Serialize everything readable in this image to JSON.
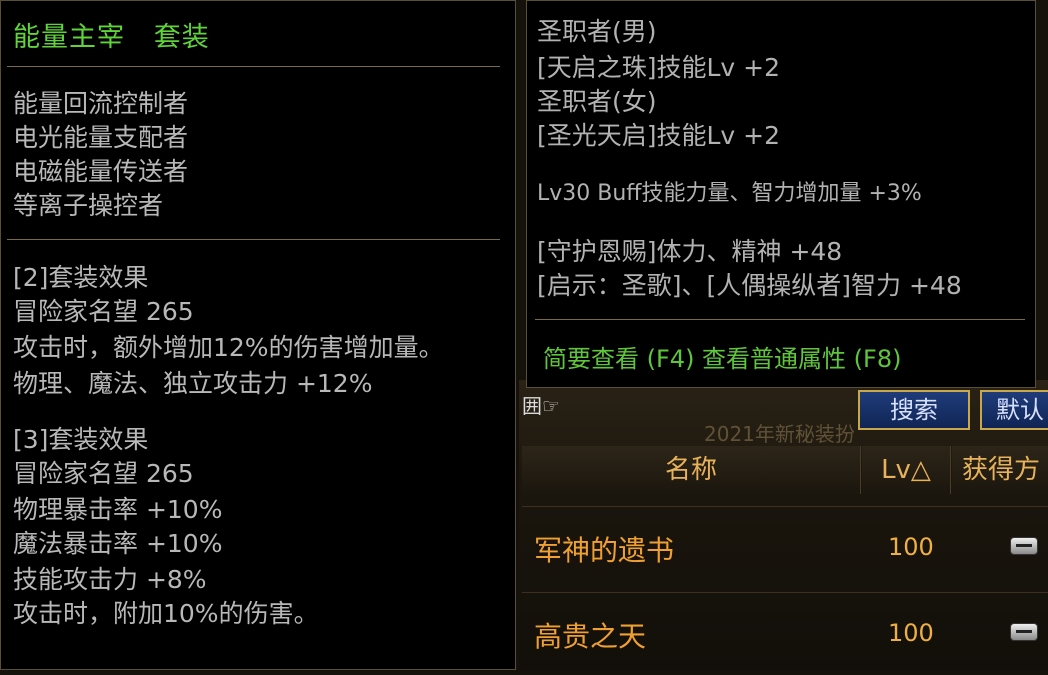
{
  "left_tooltip": {
    "title": "能量主宰   套装",
    "roles": [
      "能量回流控制者",
      "电光能量支配者",
      "电磁能量传送者",
      "等离子操控者"
    ],
    "set2": {
      "header": "[2]套装效果",
      "lines": [
        "冒险家名望 265",
        "攻击时，额外增加12%的伤害增加量。",
        "物理、魔法、独立攻击力 +12%"
      ]
    },
    "set3": {
      "header": "[3]套装效果",
      "lines": [
        "冒险家名望 265",
        "物理暴击率 +10%",
        "魔法暴击率 +10%",
        "技能攻击力 +8%",
        "攻击时，附加10%的伤害。"
      ]
    }
  },
  "right_tooltip": {
    "lines": [
      "圣职者(男)",
      "[天启之珠]技能Lv +2",
      "圣职者(女)",
      "[圣光天启]技能Lv +2"
    ],
    "buff_line": "Lv30 Buff技能力量、智力增加量 +3%",
    "lines2": [
      "[守护恩赐]体力、精神 +48",
      "[启示：圣歌]、[人偶操纵者]智力 +48"
    ],
    "shortcut": "简要查看 (F4) 查看普通属性 (F8)"
  },
  "background_ui": {
    "cursor_text": "囲",
    "search_button": "搜索",
    "default_button": "默认",
    "faded_title": "2021年新秘装扮",
    "columns": [
      "名称",
      "Lv△",
      "获得方"
    ],
    "rows": [
      {
        "name": "军神的遗书",
        "lv": "100"
      },
      {
        "name": "高贵之天",
        "lv": "100"
      }
    ]
  }
}
